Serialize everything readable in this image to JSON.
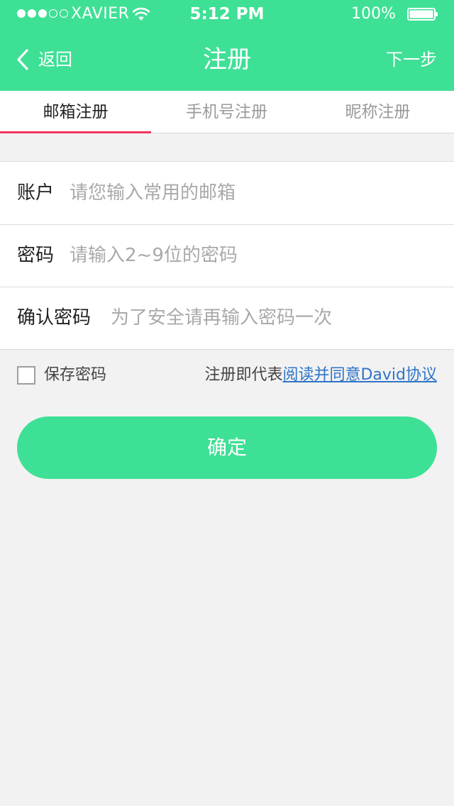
{
  "status_bar": {
    "carrier": "XAVIER",
    "time": "5:12 PM",
    "battery": "100%",
    "signal_bars_filled": 3,
    "signal_bars_total": 5
  },
  "nav": {
    "back_label": "返回",
    "title": "注册",
    "next_label": "下一步"
  },
  "tabs": [
    {
      "label": "邮箱注册",
      "active": true
    },
    {
      "label": "手机号注册",
      "active": false
    },
    {
      "label": "昵称注册",
      "active": false
    }
  ],
  "form": {
    "account": {
      "label": "账户",
      "value": "",
      "placeholder": "请您输入常用的邮箱"
    },
    "password": {
      "label": "密码",
      "value": "",
      "placeholder": "请输入2~9位的密码"
    },
    "confirm_password": {
      "label": "确认密码",
      "value": "",
      "placeholder": "为了安全请再输入密码一次"
    }
  },
  "options": {
    "save_password_label": "保存密码",
    "save_password_checked": false,
    "agreement_prefix": "注册即代表",
    "agreement_link": "阅读并同意David协议"
  },
  "confirm_button": "确定",
  "colors": {
    "brand": "#3ee095",
    "tab_indicator": "#f2335e",
    "link": "#2e74c9",
    "background": "#f2f2f2"
  }
}
